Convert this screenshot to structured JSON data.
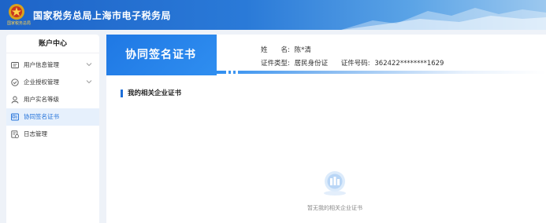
{
  "header": {
    "title": "国家税务总局上海市电子税务局",
    "emblem_caption": "国家税务总局"
  },
  "sidebar": {
    "title": "账户中心",
    "items": [
      {
        "label": "用户信息管理",
        "icon": "user-card-icon",
        "expandable": true
      },
      {
        "label": "企业授权管理",
        "icon": "shield-check-icon",
        "expandable": true
      },
      {
        "label": "用户实名等级",
        "icon": "person-icon",
        "expandable": false
      },
      {
        "label": "协同签名证书",
        "icon": "certificate-icon",
        "expandable": false,
        "active": true
      },
      {
        "label": "日志管理",
        "icon": "log-icon",
        "expandable": false
      }
    ]
  },
  "main": {
    "banner_title": "协同签名证书",
    "name_label": "姓　　名:",
    "name_value": "陈*清",
    "id_type_label": "证件类型:",
    "id_type_value": "居民身份证",
    "id_no_label": "证件号码:",
    "id_no_value": "362422********1629",
    "section_title": "我的相关企业证书",
    "empty_text": "暂无我的相关企业证书"
  },
  "colors": {
    "accent": "#1e6fd9",
    "active_bg": "#e6f0fc",
    "header_start": "#1e64c8",
    "header_end": "#9cc8ef"
  }
}
